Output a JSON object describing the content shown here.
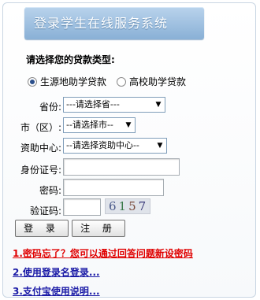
{
  "header": {
    "title": "登录学生在线服务系统"
  },
  "loan_type": {
    "title": "请选择您的贷款类型:",
    "options": [
      {
        "label": "生源地助学贷款",
        "selected": true
      },
      {
        "label": "高校助学贷款",
        "selected": false
      }
    ]
  },
  "form": {
    "province": {
      "label": "省份:",
      "value": "---请选择省---"
    },
    "city": {
      "label": "市（区）:",
      "value": "--请选择市--"
    },
    "center": {
      "label": "资助中心:",
      "value": "--请选择资助中心--"
    },
    "id_number": {
      "label": "身份证号:",
      "value": ""
    },
    "password": {
      "label": "密码:",
      "value": ""
    },
    "captcha": {
      "label": "验证码:",
      "value": "",
      "image_text": "6157"
    }
  },
  "buttons": {
    "login": "登 录",
    "register": "注 册"
  },
  "links": [
    {
      "text": "1.密码忘了？您可以通过回答问题新设密码"
    },
    {
      "text": "2.使用登录名登录..."
    },
    {
      "text": "3.支付宝使用说明..."
    }
  ]
}
